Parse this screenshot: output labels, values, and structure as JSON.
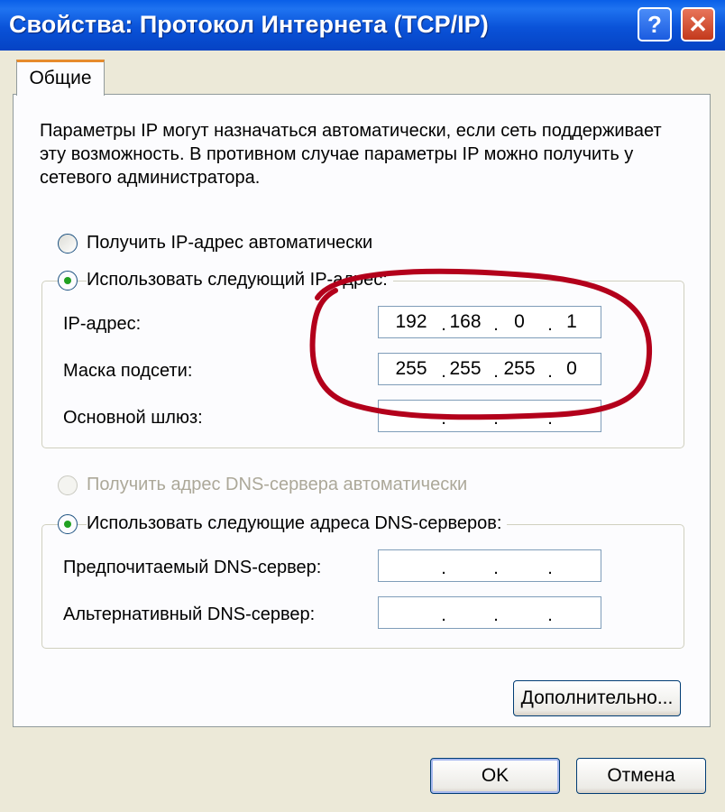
{
  "window": {
    "title": "Свойства: Протокол Интернета (TCP/IP)",
    "help_glyph": "?",
    "close_glyph": "✕"
  },
  "tabs": [
    {
      "label": "Общие",
      "selected": true
    }
  ],
  "description": "Параметры IP могут назначаться автоматически, если сеть поддерживает эту возможность. В противном случае параметры IP можно получить у сетевого администратора.",
  "ip": {
    "auto_label": "Получить IP-адрес автоматически",
    "manual_label": "Использовать следующий IP-адрес:",
    "selected": "manual",
    "fields": [
      {
        "label": "IP-адрес:",
        "octets": [
          "192",
          "168",
          "0",
          "1"
        ]
      },
      {
        "label": "Маска подсети:",
        "octets": [
          "255",
          "255",
          "255",
          "0"
        ]
      },
      {
        "label": "Основной шлюз:",
        "octets": [
          "",
          "",
          "",
          ""
        ]
      }
    ]
  },
  "dns": {
    "auto_label": "Получить адрес DNS-сервера автоматически",
    "manual_label": "Использовать следующие адреса DNS-серверов:",
    "selected": "manual",
    "auto_enabled": false,
    "fields": [
      {
        "label": "Предпочитаемый DNS-сервер:",
        "octets": [
          "",
          "",
          "",
          ""
        ]
      },
      {
        "label": "Альтернативный DNS-сервер:",
        "octets": [
          "",
          "",
          "",
          ""
        ]
      }
    ]
  },
  "buttons": {
    "advanced": "Дополнительно...",
    "ok": "OK",
    "cancel": "Отмена"
  },
  "colors": {
    "titlebar": "#0a52d8",
    "annotation_ring": "#b3001b",
    "radio_dot": "#21a121"
  }
}
